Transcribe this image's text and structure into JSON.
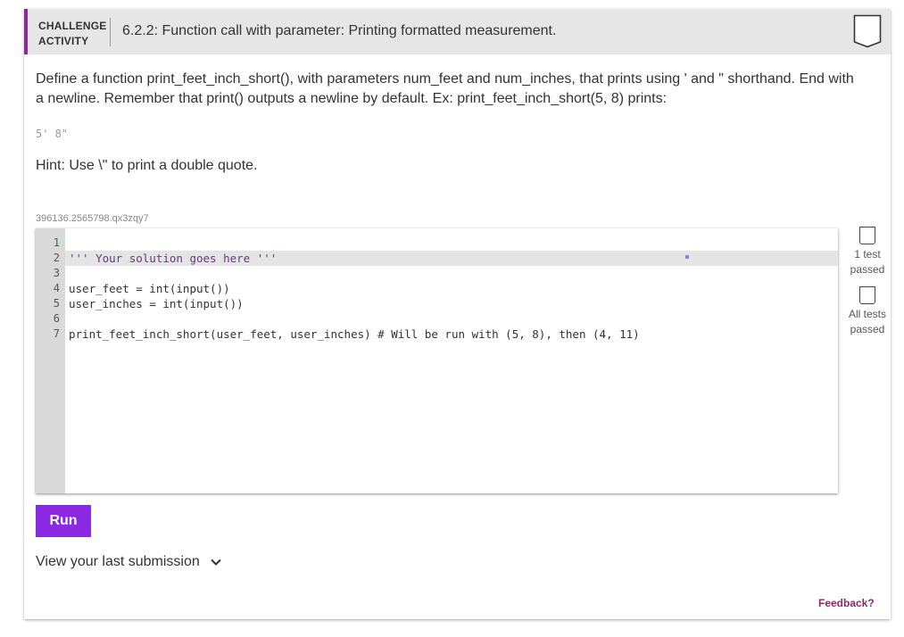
{
  "header": {
    "label_line1": "CHALLENGE",
    "label_line2": "ACTIVITY",
    "title": "6.2.2: Function call with parameter: Printing formatted measurement."
  },
  "description": "Define a function print_feet_inch_short(), with parameters num_feet and num_inches, that prints using ' and \" shorthand. End with a newline. Remember that print() outputs a newline by default. Ex: print_feet_inch_short(5, 8) prints:",
  "example_output": "5' 8\"",
  "hint": "Hint: Use \\\" to print a double quote.",
  "code_id": "396136.2565798.qx3zqy7",
  "editor": {
    "line_numbers": [
      "1",
      "2",
      "3",
      "4",
      "5",
      "6",
      "7"
    ],
    "lines": [
      "",
      "''' Your solution goes here '''",
      "",
      "user_feet = int(input())",
      "user_inches = int(input())",
      "",
      "print_feet_inch_short(user_feet, user_inches) # Will be run with (5, 8), then (4, 11)"
    ]
  },
  "tests": {
    "test1_line1": "1 test",
    "test1_line2": "passed",
    "test2_line1": "All tests",
    "test2_line2": "passed"
  },
  "run_label": "Run",
  "last_submission_label": "View your last submission",
  "feedback_label": "Feedback?",
  "colors": {
    "accent": "#8a2a9b",
    "run_button": "#8a28e2",
    "feedback": "#8a2a6b"
  }
}
